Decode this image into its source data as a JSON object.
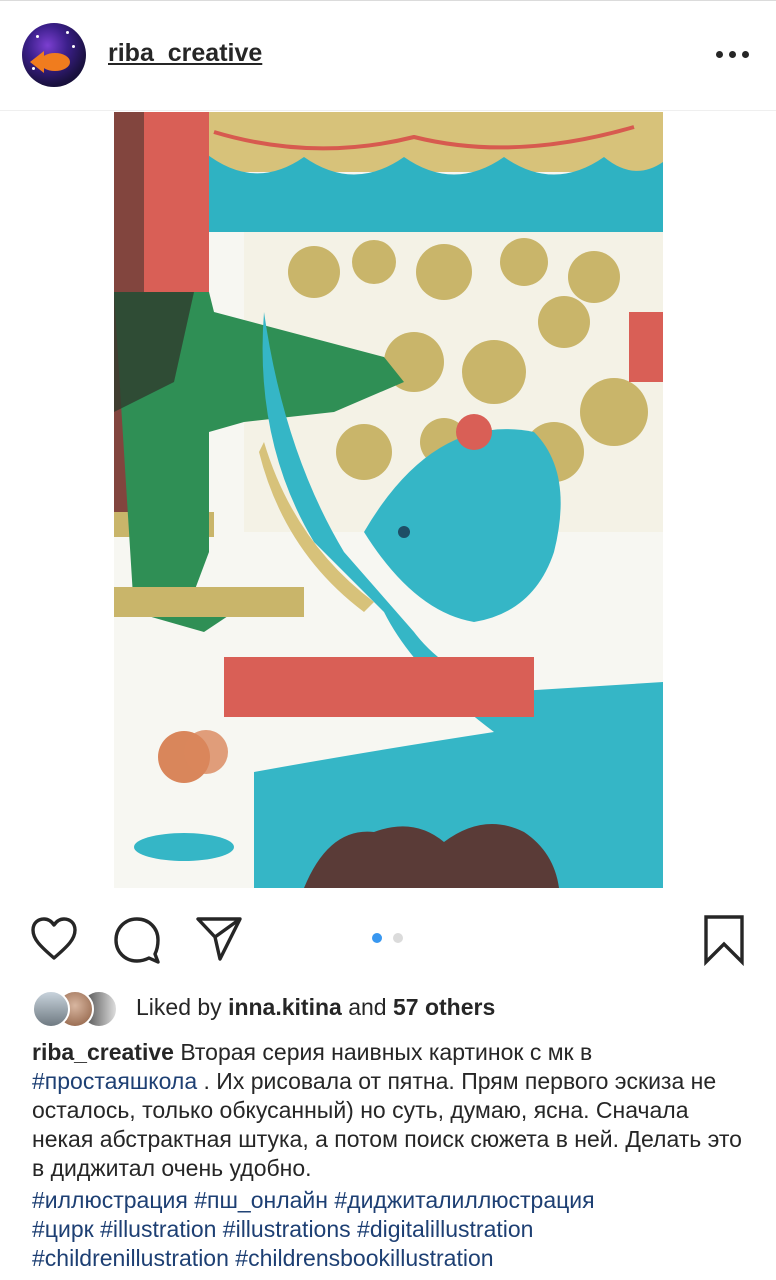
{
  "post": {
    "username": "riba_creative",
    "more_icon": "more-horizontal-icon"
  },
  "actions": {
    "like_icon": "heart-icon",
    "comment_icon": "comment-icon",
    "share_icon": "send-icon",
    "save_icon": "bookmark-icon",
    "carousel_current": 1,
    "carousel_total": 2,
    "accent": "#3897f0"
  },
  "likes": {
    "prefix": "Liked by",
    "user": "inna.kitina",
    "and": "and",
    "others": "57 others"
  },
  "caption": {
    "username": "riba_creative",
    "text_part1": "Вторая серия наивных картинок с мк в",
    "hashtag_inline": "#простаяшкола",
    "text_part2": ". Их рисовала от пятна. Прям первого эскиза не осталось, только обкусанный) но суть, думаю, ясна. Сначала некая абстрактная штука, а потом поиск сюжета в ней. Делать это в диджитал очень удобно."
  },
  "hashtags": [
    "#иллюстрация",
    "#пш_онлайн",
    "#диджиталиллюстрация",
    "#цирк",
    "#illustration",
    "#illustrations",
    "#digitalillustration",
    "#childrenillustration",
    "#childrensbookillustration"
  ]
}
